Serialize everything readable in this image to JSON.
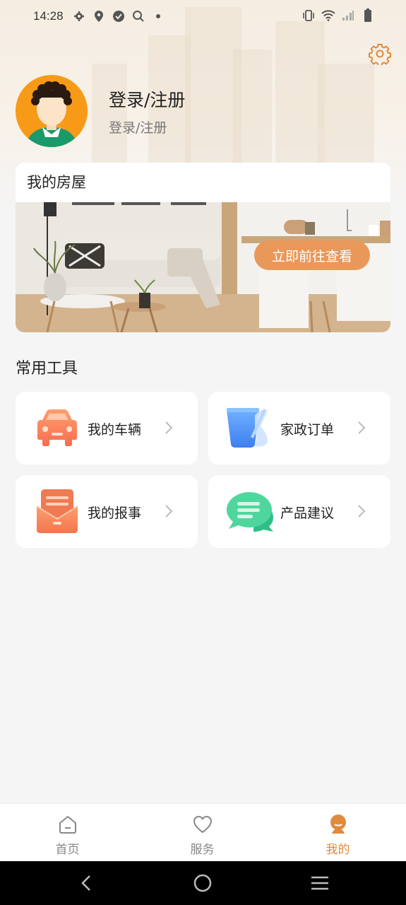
{
  "status_bar": {
    "time": "14:28"
  },
  "profile": {
    "title": "登录/注册",
    "subtitle": "登录/注册"
  },
  "house": {
    "title": "我的房屋",
    "button_label": "立即前往查看"
  },
  "tools": {
    "section_title": "常用工具",
    "items": [
      {
        "label": "我的车辆",
        "icon": "car-icon"
      },
      {
        "label": "家政订单",
        "icon": "cleaning-bucket-icon"
      },
      {
        "label": "我的报事",
        "icon": "report-envelope-icon"
      },
      {
        "label": "产品建议",
        "icon": "chat-bubble-icon"
      }
    ]
  },
  "tabbar": {
    "items": [
      {
        "label": "首页",
        "icon": "home-icon",
        "active": false
      },
      {
        "label": "服务",
        "icon": "heart-icon",
        "active": false
      },
      {
        "label": "我的",
        "icon": "person-icon",
        "active": true
      }
    ]
  },
  "colors": {
    "accent": "#e08a3d",
    "button": "#e9985a",
    "avatar_bg": "#f79a17",
    "page_bg": "#f5f5f5"
  }
}
